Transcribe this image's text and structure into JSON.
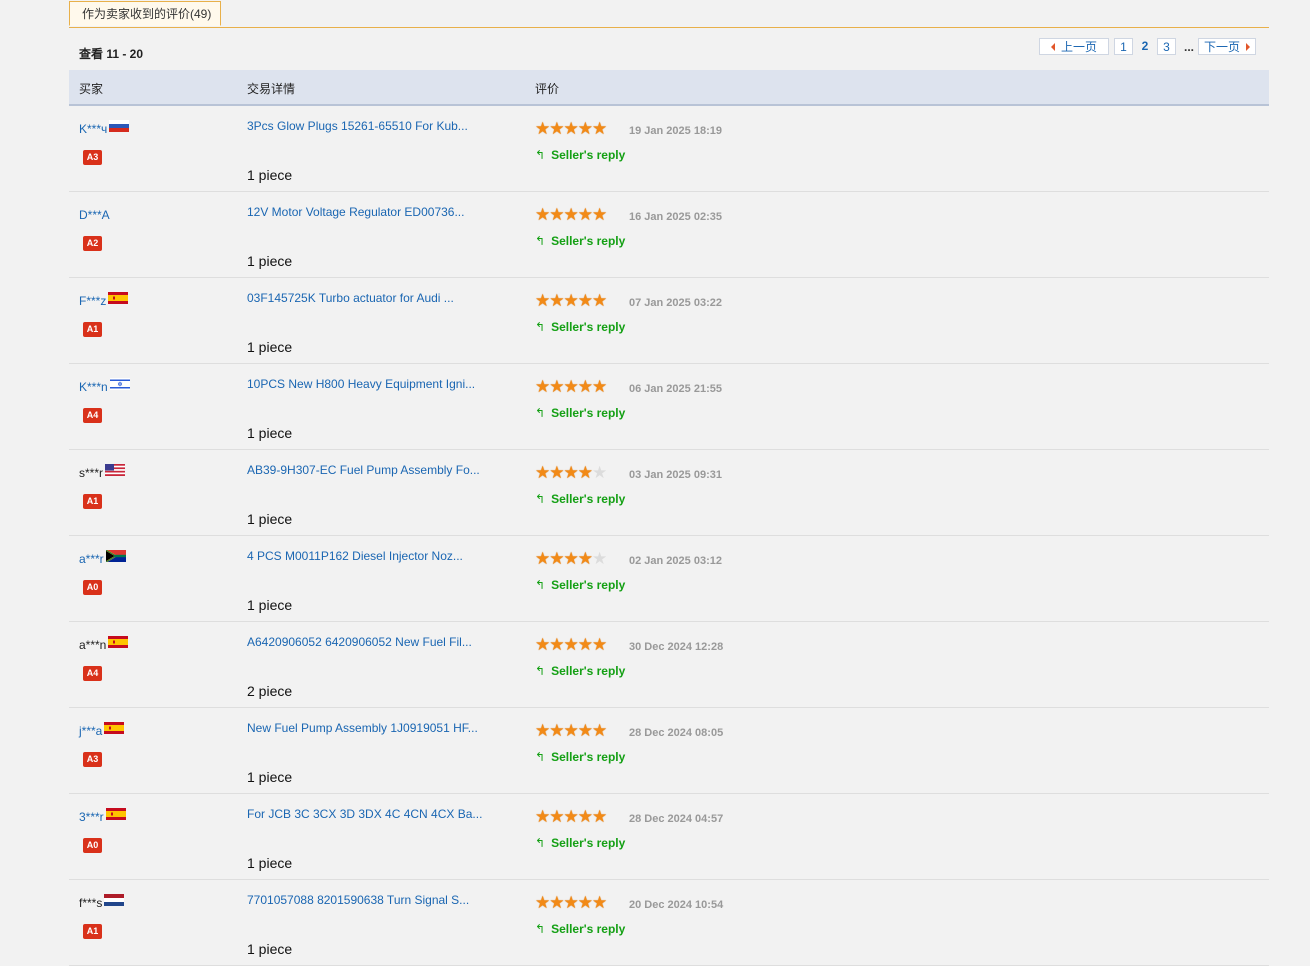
{
  "tab": {
    "label": "作为卖家收到的评价(49)"
  },
  "range_text": "查看 11 - 20",
  "pager": {
    "prev": "上一页",
    "pages": [
      "1",
      "2",
      "3"
    ],
    "current": "2",
    "ellipsis": "...",
    "next": "下一页"
  },
  "columns": {
    "buyer": "买家",
    "details": "交易详情",
    "review": "评价"
  },
  "colors": {
    "accent": "#e8b04a",
    "link": "#1a66b2",
    "badge": "#d9311a",
    "reply": "#14a014",
    "star": "#f28a17"
  },
  "reply_label": "Seller's reply",
  "rows": [
    {
      "buyer": "K***ч",
      "flag": "ru",
      "badge": "A3",
      "product": "3Pcs Glow Plugs 15261-65510 For Kub...",
      "qty": "1 piece",
      "stars": 5,
      "date": "19 Jan 2025 18:19",
      "link": true
    },
    {
      "buyer": "D***A",
      "flag": "",
      "badge": "A2",
      "product": "12V Motor Voltage Regulator ED00736...",
      "qty": "1 piece",
      "stars": 5,
      "date": "16 Jan 2025 02:35",
      "link": true
    },
    {
      "buyer": "F***z",
      "flag": "es",
      "badge": "A1",
      "product": "03F145725K Turbo actuator for Audi ...",
      "qty": "1 piece",
      "stars": 5,
      "date": "07 Jan 2025 03:22",
      "link": true
    },
    {
      "buyer": "K***n",
      "flag": "il",
      "badge": "A4",
      "product": "10PCS New H800 Heavy Equipment Igni...",
      "qty": "1 piece",
      "stars": 5,
      "date": "06 Jan 2025 21:55",
      "link": true
    },
    {
      "buyer": "s***r",
      "flag": "us",
      "badge": "A1",
      "product": "AB39-9H307-EC Fuel Pump Assembly Fo...",
      "qty": "1 piece",
      "stars": 4,
      "date": "03 Jan 2025 09:31",
      "link": false
    },
    {
      "buyer": "a***r",
      "flag": "za",
      "badge": "A0",
      "product": "4 PCS M0011P162 Diesel Injector Noz...",
      "qty": "1 piece",
      "stars": 4,
      "date": "02 Jan 2025 03:12",
      "link": true
    },
    {
      "buyer": "a***n",
      "flag": "es",
      "badge": "A4",
      "product": "A6420906052 6420906052 New Fuel Fil...",
      "qty": "2 piece",
      "stars": 5,
      "date": "30 Dec 2024 12:28",
      "link": false
    },
    {
      "buyer": "j***a",
      "flag": "es",
      "badge": "A3",
      "product": "New Fuel Pump Assembly 1J0919051 HF...",
      "qty": "1 piece",
      "stars": 5,
      "date": "28 Dec 2024 08:05",
      "link": true
    },
    {
      "buyer": "3***r",
      "flag": "es",
      "badge": "A0",
      "product": "For JCB 3C 3CX 3D 3DX 4C 4CN 4CX Ba...",
      "qty": "1 piece",
      "stars": 5,
      "date": "28 Dec 2024 04:57",
      "link": true
    },
    {
      "buyer": "f***s",
      "flag": "nl",
      "badge": "A1",
      "product": "7701057088 8201590638 Turn Signal S...",
      "qty": "1 piece",
      "stars": 5,
      "date": "20 Dec 2024 10:54",
      "link": false
    }
  ]
}
